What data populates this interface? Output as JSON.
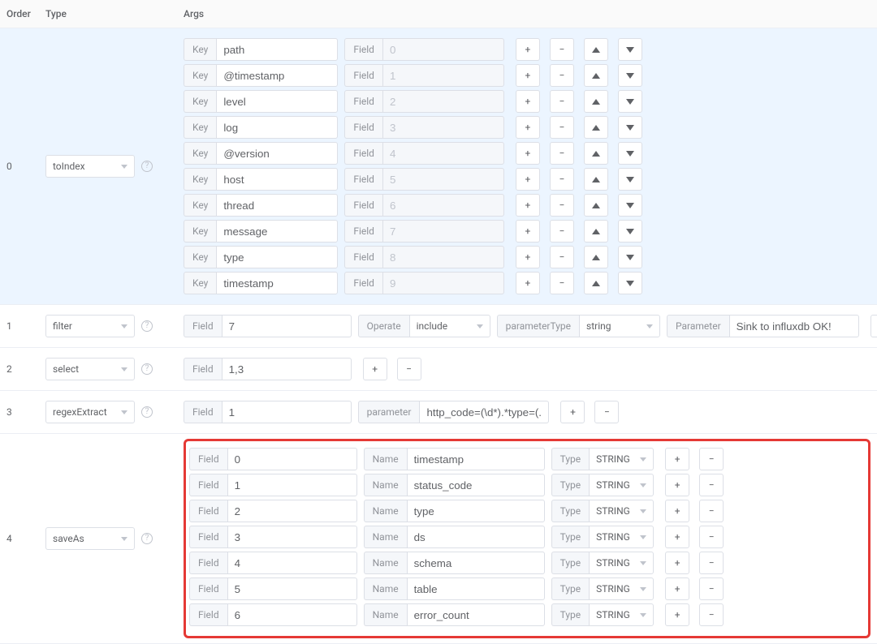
{
  "columns": {
    "order": "Order",
    "type": "Type",
    "args": "Args"
  },
  "labels": {
    "key": "Key",
    "field": "Field",
    "operate": "Operate",
    "parameterType": "parameterType",
    "parameter": "Parameter",
    "parameter_lc": "parameter",
    "name": "Name",
    "type": "Type",
    "help": "?"
  },
  "rows": [
    {
      "order": "0",
      "type": "toIndex",
      "highlight": true,
      "layout": "keyfield",
      "items": [
        {
          "key": "path",
          "field": "0"
        },
        {
          "key": "@timestamp",
          "field": "1"
        },
        {
          "key": "level",
          "field": "2"
        },
        {
          "key": "log",
          "field": "3"
        },
        {
          "key": "@version",
          "field": "4"
        },
        {
          "key": "host",
          "field": "5"
        },
        {
          "key": "thread",
          "field": "6"
        },
        {
          "key": "message",
          "field": "7"
        },
        {
          "key": "type",
          "field": "8"
        },
        {
          "key": "timestamp",
          "field": "9"
        }
      ]
    },
    {
      "order": "1",
      "type": "filter",
      "layout": "filter",
      "filter": {
        "field": "7",
        "operate": "include",
        "parameterType": "string",
        "parameter": "Sink to influxdb OK!"
      }
    },
    {
      "order": "2",
      "type": "select",
      "layout": "select",
      "select": {
        "field": "1,3"
      }
    },
    {
      "order": "3",
      "type": "regexExtract",
      "layout": "regex",
      "regex": {
        "field": "1",
        "parameter": "http_code=(\\d*).*type=(.*),("
      }
    },
    {
      "order": "4",
      "type": "saveAs",
      "layout": "saveas",
      "redbox": true,
      "items": [
        {
          "field": "0",
          "name": "timestamp",
          "type": "STRING"
        },
        {
          "field": "1",
          "name": "status_code",
          "type": "STRING"
        },
        {
          "field": "2",
          "name": "type",
          "type": "STRING"
        },
        {
          "field": "3",
          "name": "ds",
          "type": "STRING"
        },
        {
          "field": "4",
          "name": "schema",
          "type": "STRING"
        },
        {
          "field": "5",
          "name": "table",
          "type": "STRING"
        },
        {
          "field": "6",
          "name": "error_count",
          "type": "STRING"
        }
      ]
    }
  ]
}
